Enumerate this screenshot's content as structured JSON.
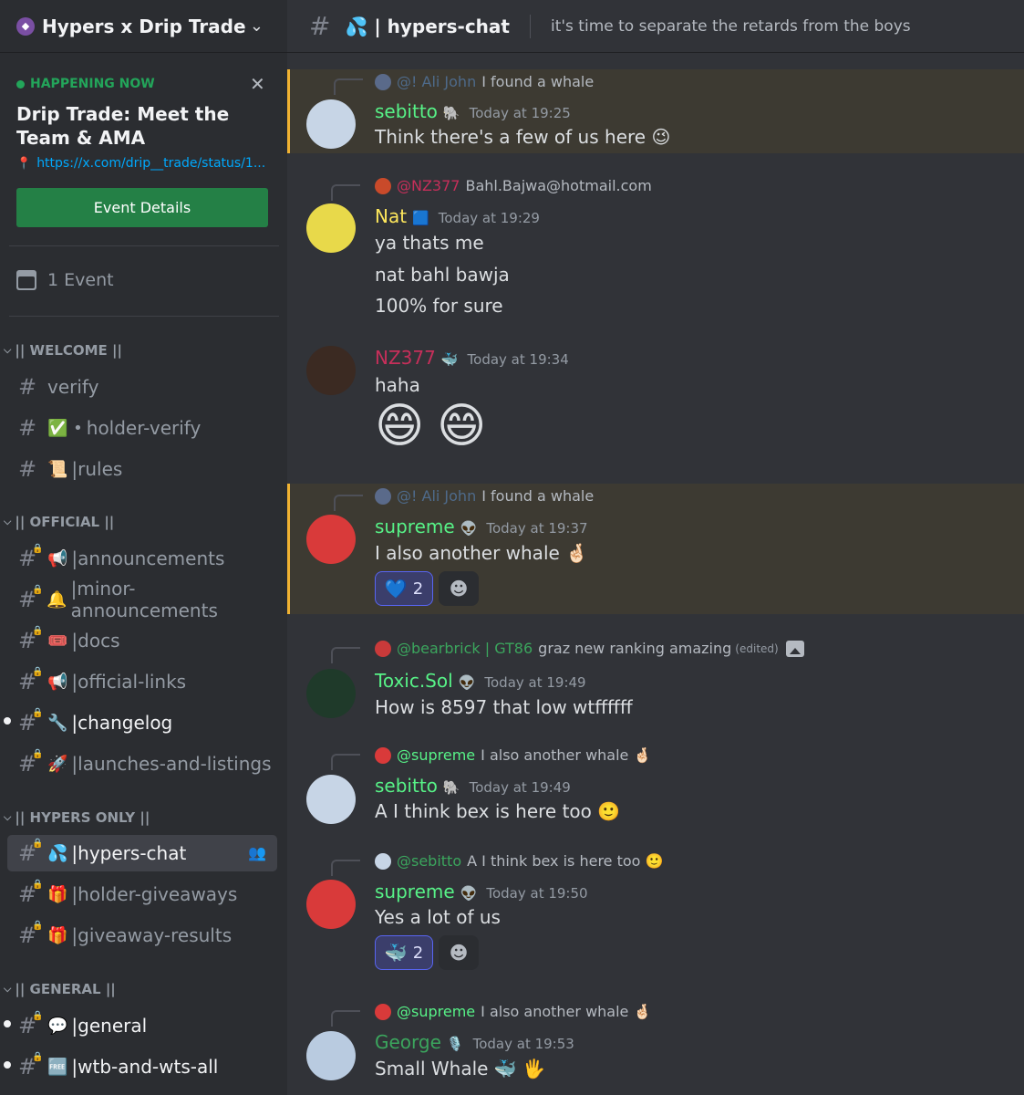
{
  "server": {
    "name": "Hypers x Drip Trade"
  },
  "event": {
    "status": "HAPPENING NOW",
    "title": "Drip Trade: Meet the Team & AMA",
    "link": "https://x.com/drip__trade/status/1...",
    "button": "Event Details",
    "count_label": "1 Event"
  },
  "categories": {
    "welcome": "|| WELCOME ||",
    "official": "|| OFFICIAL ||",
    "hypers_only": "|| HYPERS ONLY ||",
    "general": "|| GENERAL ||"
  },
  "channels": {
    "verify": "verify",
    "holder_verify": "holder-verify",
    "rules": "|rules",
    "announcements": "|announcements",
    "minor_announcements": "|minor-announcements",
    "docs": "|docs",
    "official_links": "|official-links",
    "changelog": "|changelog",
    "launches": "|launches-and-listings",
    "hypers_chat": "|hypers-chat",
    "holder_giveaways": "|holder-giveaways",
    "giveaway_results": "|giveaway-results",
    "general": "|general",
    "wtb": "|wtb-and-wts-all"
  },
  "channel_emojis": {
    "holder_verify": "✅ •",
    "rules": "📜",
    "announcements": "📢",
    "minor_announcements": "🔔",
    "docs": "🎟️",
    "official_links": "📢",
    "changelog": "🔧",
    "launches": "🚀",
    "hypers_chat": "💦",
    "holder_giveaways": "🎁",
    "giveaway_results": "🎁",
    "general": "💬",
    "wtb": "🆓"
  },
  "topbar": {
    "channel": "💦 | hypers-chat",
    "topic": "it's time to separate the retards from the boys"
  },
  "colors": {
    "accent": "#5865f2",
    "green": "#23a55a",
    "highlight": "#f0b232"
  },
  "messages": [
    {
      "reply_mention": "@! Ali John",
      "reply_text": "I found a whale",
      "user": "sebitto",
      "user_color": "#57f287",
      "badge": "🐘",
      "time": "Today at 19:25",
      "lines": [
        "Think there's a few of us here 😉"
      ]
    },
    {
      "reply_mention": "@NZ377",
      "reply_text": "Bahl.Bajwa@hotmail.com",
      "user": "Nat",
      "user_color": "#fee75c",
      "badge": "🟦",
      "time": "Today at 19:29",
      "lines": [
        "ya thats me",
        "nat bahl bawja",
        "100% for sure"
      ]
    },
    {
      "user": "NZ377",
      "user_color": "#c62f5a",
      "badge": "🐳",
      "time": "Today at 19:34",
      "lines": [
        "haha"
      ],
      "big_emoji": "😄"
    },
    {
      "reply_mention": "@! Ali John",
      "reply_text": "I found a whale",
      "user": "supreme",
      "user_color": "#57f287",
      "badge": "👽",
      "time": "Today at 19:37",
      "lines": [
        "I also another whale 🤞🏻"
      ],
      "reaction": {
        "emoji": "💙",
        "count": "2"
      }
    },
    {
      "reply_mention": "@bearbrick | GT86",
      "reply_text": "graz new ranking amazing",
      "reply_edited": "(edited)",
      "user": "Toxic.Sol",
      "user_color": "#57f287",
      "badge": "👽",
      "time": "Today at 19:49",
      "lines": [
        "How is 8597 that low wtffffff"
      ]
    },
    {
      "reply_mention": "@supreme",
      "reply_text": "I also another whale 🤞🏻",
      "user": "sebitto",
      "user_color": "#57f287",
      "badge": "🐘",
      "time": "Today at 19:49",
      "lines": [
        "A I think bex is here too 🙂"
      ]
    },
    {
      "reply_mention": "@sebitto",
      "reply_text": "A I think bex is here too 🙂",
      "user": "supreme",
      "user_color": "#57f287",
      "badge": "👽",
      "time": "Today at 19:50",
      "lines": [
        "Yes a lot of us"
      ],
      "reaction": {
        "emoji": "🐳",
        "count": "2"
      }
    },
    {
      "reply_mention": "@supreme",
      "reply_text": "I also another whale 🤞🏻",
      "user": "George",
      "user_color": "#3ba55d",
      "badge": "🎙️",
      "time": "Today at 19:53",
      "lines": [
        "Small Whale 🐳 🖐️"
      ]
    }
  ]
}
